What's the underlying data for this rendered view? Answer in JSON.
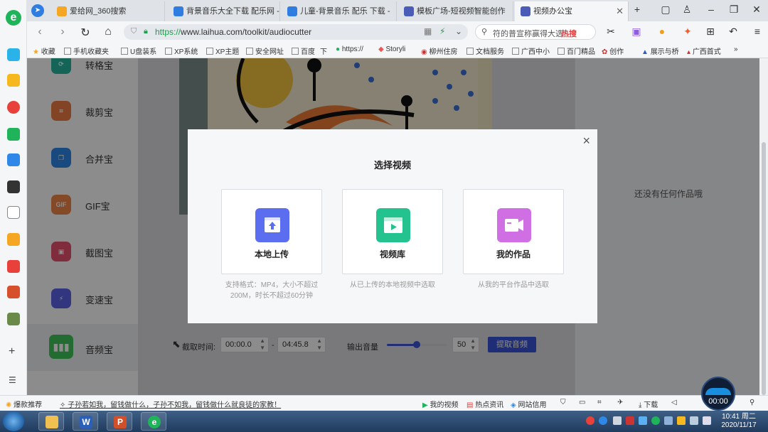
{
  "browser": {
    "tabs": [
      {
        "label": "爱给网_360搜索",
        "active": false
      },
      {
        "label": "背景音乐大全下载 配乐网 -",
        "active": false
      },
      {
        "label": "儿童-背景音乐 配乐 下载 -",
        "active": false
      },
      {
        "label": "模板广场-短视频智能创作",
        "active": false
      },
      {
        "label": "视频办公宝",
        "active": true
      }
    ],
    "url_protocol": "https://",
    "url_rest": "www.laihua.com/toolkit/audiocutter",
    "search_placeholder": "符的普宣称赢得大选",
    "search_hot": "热搜",
    "bookmarks": [
      "收藏",
      "手机收藏夹",
      "U盘装系",
      "XP系统",
      "XP主题",
      "安全网址",
      "百度",
      "下",
      "https://",
      "Storyli",
      "柳州住房",
      "文档服务",
      "广西中小",
      "百门精品",
      "创作",
      "展示与桥",
      "广西首式",
      "»"
    ]
  },
  "sidenav": {
    "items": [
      {
        "label": "转格宝",
        "icon": "convert-icon",
        "color": "#26b8a0"
      },
      {
        "label": "裁剪宝",
        "icon": "crop-icon",
        "color": "#ef7c45"
      },
      {
        "label": "合并宝",
        "icon": "merge-icon",
        "color": "#2f88e8"
      },
      {
        "label": "GIF宝",
        "icon_text": "GIF",
        "icon": "gif-icon",
        "color": "#f08645"
      },
      {
        "label": "截图宝",
        "icon": "screenshot-icon",
        "color": "#e8506d"
      },
      {
        "label": "变速宝",
        "icon": "speed-icon",
        "color": "#5a63e8"
      },
      {
        "label": "音频宝",
        "icon": "audio-icon",
        "color": "#3fc55a"
      }
    ]
  },
  "main": {
    "empty_text": "还没有任何作品哦",
    "cut_time_label": "截取时间:",
    "start_time": "00:00.0",
    "dash": "-",
    "end_time": "04:45.8",
    "volume_label": "输出音量",
    "volume_value": "50",
    "volume_fraction": 0.5,
    "extract_button": "提取音频"
  },
  "modal": {
    "title": "选择视频",
    "close": "×",
    "cards": [
      {
        "label": "本地上传",
        "desc": "支持格式：MP4，大小不超过200M，时长不超过60分钟",
        "color": "#5b6ef0",
        "icon": "upload-icon"
      },
      {
        "label": "视频库",
        "desc": "从已上传的本地视频中选取",
        "color": "#23c28e",
        "icon": "video-library-icon"
      },
      {
        "label": "我的作品",
        "desc": "从我的平台作品中选取",
        "color": "#cf6fe3",
        "icon": "my-works-icon"
      }
    ]
  },
  "statusbar": {
    "left_label": "爆款推荐",
    "ticker": "子孙若如我，留钱做什么，子孙不如我，留钱做什么就良徒的家教！",
    "items": [
      "我的视频",
      "热点资讯",
      "网站信用",
      "下载"
    ]
  },
  "timer": "00:00",
  "taskbar": {
    "time": "10:41 周二",
    "date": "2020/11/17"
  }
}
